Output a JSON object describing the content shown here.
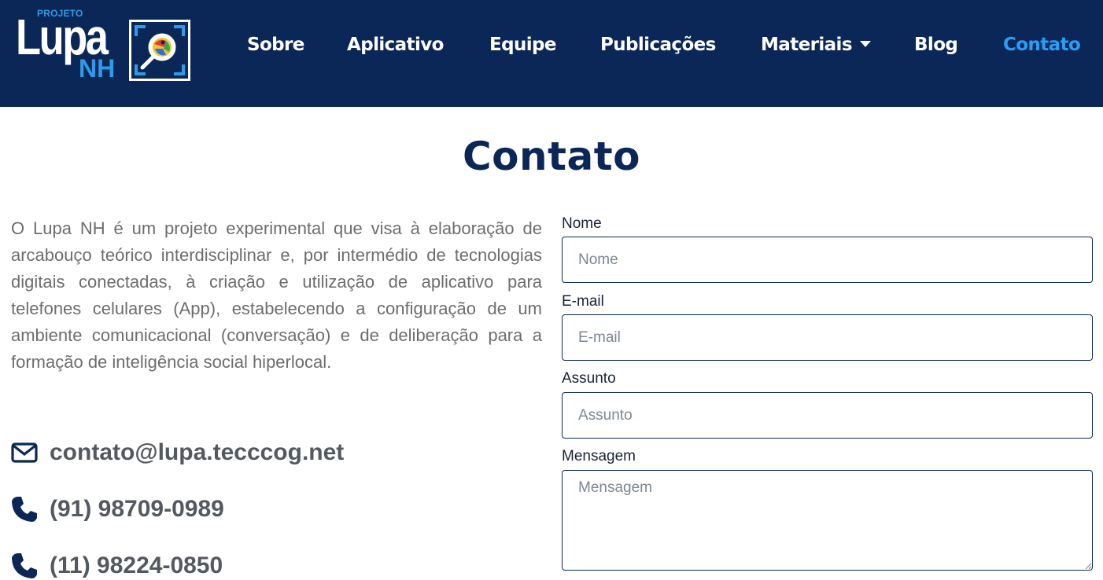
{
  "header": {
    "logo": {
      "small_text": "PROJETO",
      "main_text": "Lupa",
      "sub_text": "NH"
    },
    "nav": [
      {
        "label": "Sobre"
      },
      {
        "label": "Aplicativo"
      },
      {
        "label": "Equipe"
      },
      {
        "label": "Publicações"
      },
      {
        "label": "Materiais",
        "has_dropdown": true
      },
      {
        "label": "Blog"
      },
      {
        "label": "Contato",
        "active": true
      }
    ]
  },
  "main": {
    "title": "Contato",
    "intro": "O Lupa NH é um projeto experimental que visa à elaboração de arcabouço teórico interdisciplinar e, por intermédio de tecnologias digitais conectadas, à criação e utilização de aplicativo para telefones celulares (App), estabelecendo a configuração de um ambiente comunicacional (conversação) e de deliberação para a formação de inteligência social hiperlocal.",
    "contacts": [
      {
        "icon": "envelope-icon",
        "text": "contato@lupa.tecccog.net"
      },
      {
        "icon": "phone-icon",
        "text": "(91) 98709-0989"
      },
      {
        "icon": "phone-icon",
        "text": "(11) 98224-0850"
      }
    ]
  },
  "form": {
    "name": {
      "label": "Nome",
      "placeholder": "Nome",
      "value": ""
    },
    "email": {
      "label": "E-mail",
      "placeholder": "E-mail",
      "value": ""
    },
    "subject": {
      "label": "Assunto",
      "placeholder": "Assunto",
      "value": ""
    },
    "message": {
      "label": "Mensagem",
      "placeholder": "Mensagem",
      "value": ""
    }
  },
  "colors": {
    "header_bg": "#0b2758",
    "accent": "#2a9df4",
    "title": "#0b2758",
    "body_text": "#6d6d6d"
  }
}
